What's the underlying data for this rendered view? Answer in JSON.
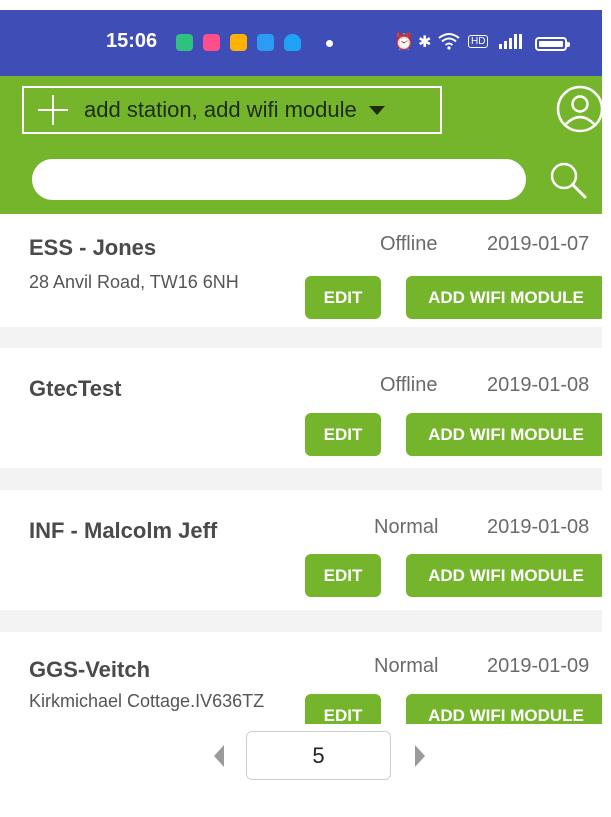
{
  "status_bar": {
    "time": "15:06",
    "colors": {
      "background": "#3f4eb7"
    }
  },
  "header": {
    "add_label": "add station, add wifi module"
  },
  "search": {
    "placeholder": ""
  },
  "stations": [
    {
      "name": "ESS - Jones",
      "status": "Offline",
      "date": "2019-01-07",
      "address": "28 Anvil Road, TW16 6NH",
      "edit_label": "EDIT",
      "add_wifi_label": "ADD WIFI MODULE"
    },
    {
      "name": "GtecTest",
      "status": "Offline",
      "date": "2019-01-08",
      "address": "",
      "edit_label": "EDIT",
      "add_wifi_label": "ADD WIFI MODULE"
    },
    {
      "name": "INF - Malcolm Jeff",
      "status": "Normal",
      "date": "2019-01-08",
      "address": "",
      "edit_label": "EDIT",
      "add_wifi_label": "ADD WIFI MODULE"
    },
    {
      "name": "GGS-Veitch",
      "status": "Normal",
      "date": "2019-01-09",
      "address": "Kirkmichael Cottage.IV636TZ",
      "edit_label": "EDIT",
      "add_wifi_label": "ADD WIFI MODULE"
    }
  ],
  "pagination": {
    "current_page": "5"
  },
  "colors": {
    "accent": "#74b52b",
    "separator": "#f3f3f3",
    "text_primary": "#4a4a4a",
    "text_secondary": "#6a6a6a"
  }
}
